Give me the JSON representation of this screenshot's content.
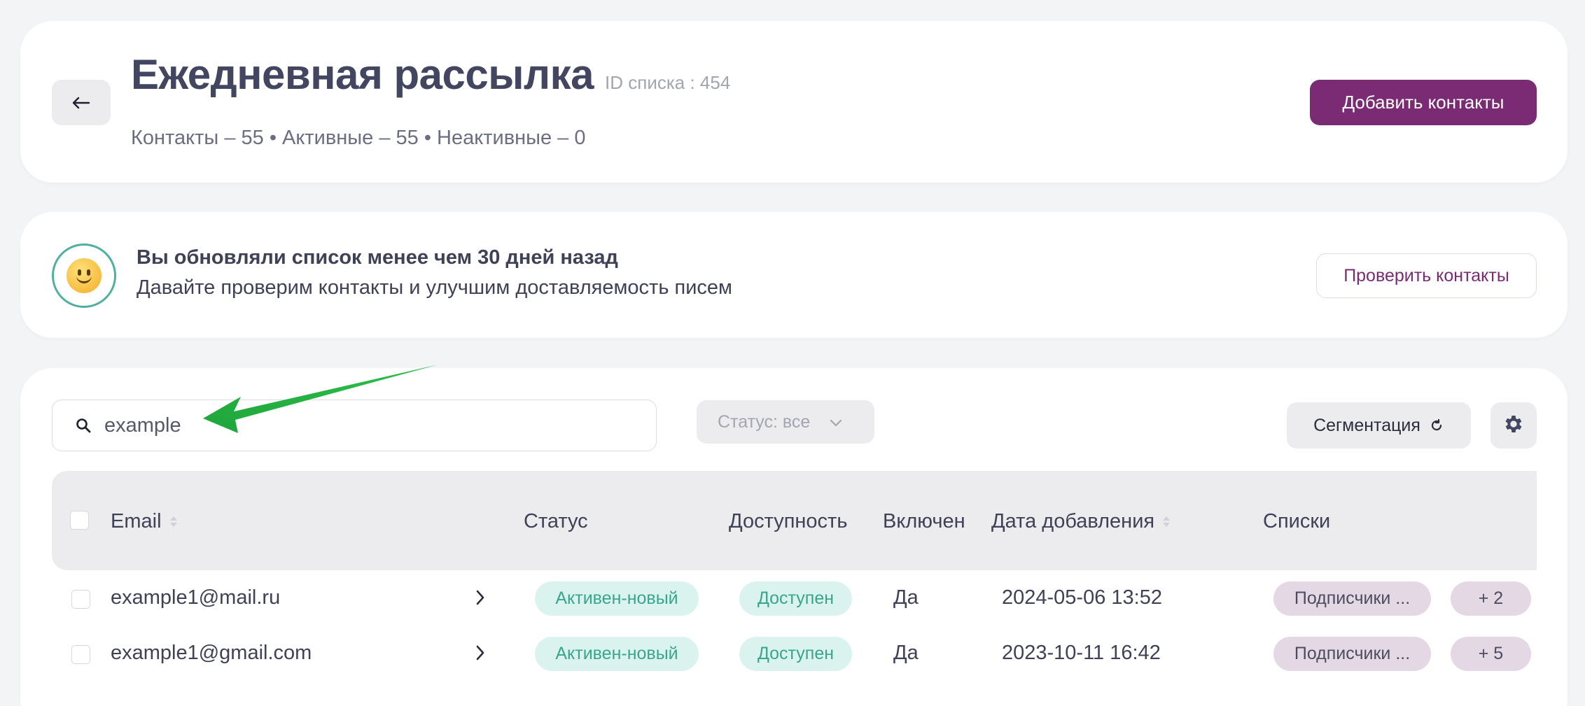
{
  "header": {
    "title": "Ежедневная рассылка",
    "list_id": "ID списка : 454",
    "stats": "Контакты – 55 • Активные – 55 • Неактивные – 0",
    "back_icon": "arrow-left-icon",
    "add_contacts_label": "Добавить контакты"
  },
  "notice": {
    "icon": "smiley-icon",
    "title": "Вы обновляли список менее чем 30 дней назад",
    "text": "Давайте проверим контакты и улучшим доставляемость писем",
    "check_label": "Проверить контакты"
  },
  "toolbar": {
    "search_value": "example",
    "status_filter_label": "Статус: все",
    "segmentation_label": "Сегментация"
  },
  "table": {
    "columns": {
      "email": "Email",
      "status": "Статус",
      "availability": "Доступность",
      "enabled": "Включен",
      "date_added": "Дата добавления",
      "lists": "Списки"
    },
    "rows": [
      {
        "email": "example1@mail.ru",
        "status": "Активен-новый",
        "availability": "Доступен",
        "enabled": "Да",
        "date_added": "2024-05-06 13:52",
        "list": "Подписчики ...",
        "more_lists": "+ 2"
      },
      {
        "email": "example1@gmail.com",
        "status": "Активен-новый",
        "availability": "Доступен",
        "enabled": "Да",
        "date_added": "2023-10-11 16:42",
        "list": "Подписчики ...",
        "more_lists": "+ 5"
      }
    ]
  },
  "colors": {
    "brand": "#7a2b73",
    "status_green_bg": "#dbf3ee",
    "status_green_text": "#3aa58d",
    "list_pill_bg": "#e4d8e5",
    "annotation_arrow": "#28b340"
  }
}
